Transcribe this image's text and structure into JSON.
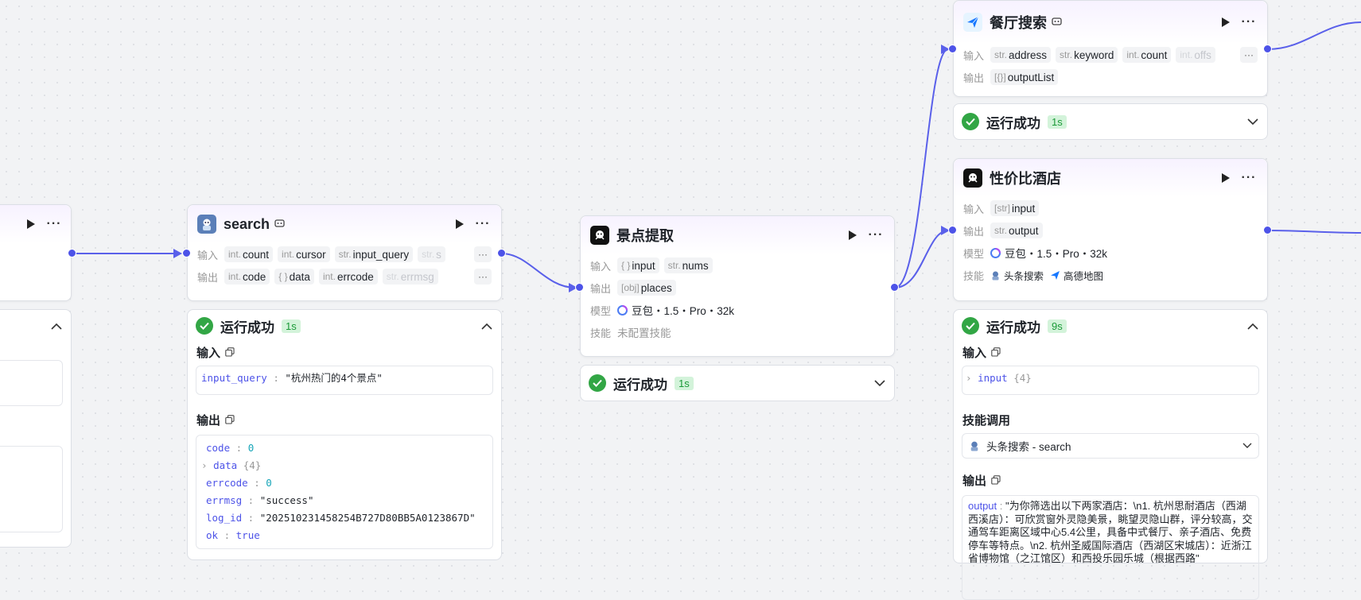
{
  "labels": {
    "input": "输入",
    "output": "输出",
    "model": "模型",
    "skill": "技能",
    "more": "···",
    "ellipsis": "···"
  },
  "status": {
    "success": "运行成功"
  },
  "nodes": {
    "prev": {},
    "search": {
      "title": "search",
      "inputs": [
        {
          "type": "int.",
          "name": "count"
        },
        {
          "type": "int.",
          "name": "cursor"
        },
        {
          "type": "str.",
          "name": "input_query"
        },
        {
          "type": "str.",
          "name": "s"
        }
      ],
      "outputs": [
        {
          "type": "int.",
          "name": "code"
        },
        {
          "type": "{ }",
          "name": "data"
        },
        {
          "type": "int.",
          "name": "errcode"
        },
        {
          "type": "str.",
          "name": "errmsg"
        }
      ],
      "run": {
        "time": "1s",
        "input_title": "输入",
        "output_title": "输出",
        "input": {
          "key": "input_query",
          "value": "\"杭州热门的4个景点\""
        },
        "output": [
          {
            "key": "code",
            "value": "0",
            "kind": "n"
          },
          {
            "key": "data",
            "value": "{4}",
            "kind": "c",
            "expand": true
          },
          {
            "key": "errcode",
            "value": "0",
            "kind": "n"
          },
          {
            "key": "errmsg",
            "value": "\"success\"",
            "kind": "s"
          },
          {
            "key": "log_id",
            "value": "\"202510231458254B727D80BB5A0123867D\"",
            "kind": "s"
          },
          {
            "key": "ok",
            "value": "true",
            "kind": "b"
          }
        ]
      }
    },
    "spots": {
      "title": "景点提取",
      "inputs": [
        {
          "type": "{ }",
          "name": "input"
        },
        {
          "type": "str.",
          "name": "nums"
        }
      ],
      "outputs": [
        {
          "type": "[obj]",
          "name": "places"
        }
      ],
      "model": "豆包・1.5・Pro・32k",
      "skill": "未配置技能",
      "run": {
        "time": "1s"
      }
    },
    "restaurant": {
      "title": "餐厅搜索",
      "inputs": [
        {
          "type": "str.",
          "name": "address"
        },
        {
          "type": "str.",
          "name": "keyword"
        },
        {
          "type": "int.",
          "name": "count"
        },
        {
          "type": "int.",
          "name": "offs"
        }
      ],
      "outputs": [
        {
          "type": "[{}]",
          "name": "outputList"
        }
      ],
      "run": {
        "time": "1s"
      }
    },
    "hotel": {
      "title": "性价比酒店",
      "inputs": [
        {
          "type": "[str]",
          "name": "input"
        }
      ],
      "outputs": [
        {
          "type": "str.",
          "name": "output"
        }
      ],
      "model": "豆包・1.5・Pro・32k",
      "skills": [
        "头条搜索",
        "高德地图"
      ],
      "run": {
        "time": "9s",
        "input_title": "输入",
        "input_key": "input",
        "input_count": "{4}",
        "skill_title": "技能调用",
        "skill_call": "头条搜索 - search",
        "output_title": "输出",
        "output_key": "output",
        "output_value": "\"为你筛选出以下两家酒店：\\n1. 杭州思耐酒店（西湖西溪店）：可欣赏窗外灵隐美景，眺望灵隐山群，评分较高，交通驾车距离区域中心5.4公里，具备中式餐厅、亲子酒店、免费停车等特点。\\n2. 杭州圣威国际酒店（西湖区宋城店）：近浙江省博物馆（之江馆区）和西投乐园乐城（根据西路\""
      }
    }
  },
  "colors": {
    "accent": "#4d53e8",
    "success": "#32a645",
    "badge_bg": "#d3f3da"
  }
}
